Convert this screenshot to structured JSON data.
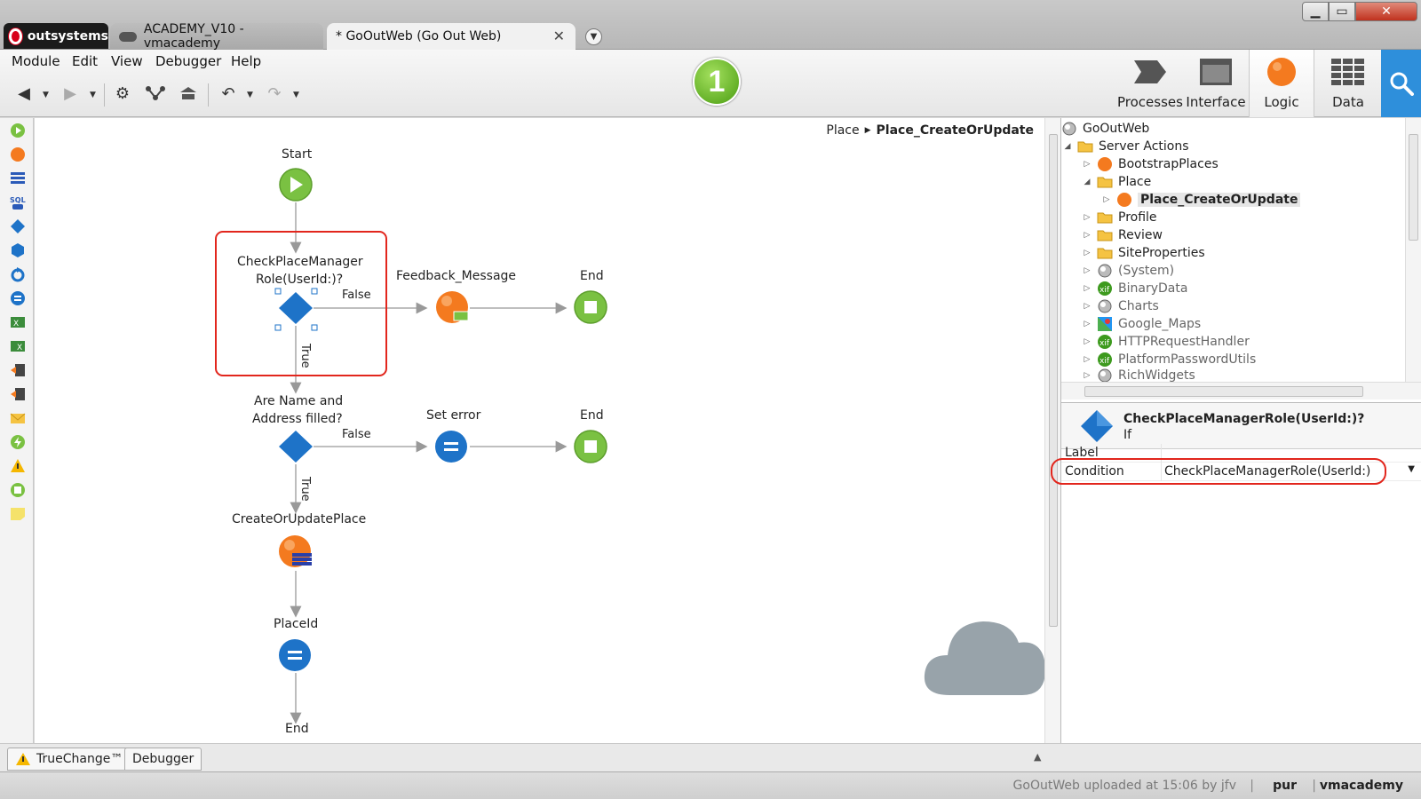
{
  "brand": {
    "name": "outsystems"
  },
  "tabs": [
    {
      "label": "ACADEMY_V10 - vmacademy"
    },
    {
      "label": "* GoOutWeb (Go Out Web)"
    }
  ],
  "window_controls": {
    "minimize": "▁",
    "maximize": "▭",
    "close": "✕"
  },
  "menu": [
    "Module",
    "Edit",
    "View",
    "Debugger",
    "Help"
  ],
  "step_badge": "1",
  "layers": [
    {
      "label": "Processes",
      "icon": "processes-icon"
    },
    {
      "label": "Interface",
      "icon": "interface-icon"
    },
    {
      "label": "Logic",
      "icon": "logic-icon",
      "active": true
    },
    {
      "label": "Data",
      "icon": "data-icon"
    }
  ],
  "breadcrumb": {
    "parent": "Place",
    "current": "Place_CreateOrUpdate"
  },
  "flow": {
    "start_label": "Start",
    "if1_label_line1": "CheckPlaceManager",
    "if1_label_line2": "Role(UserId:)?",
    "if1_false": "False",
    "if1_true": "True",
    "feedback_label": "Feedback_Message",
    "end1_label": "End",
    "if2_label_line1": "Are Name and",
    "if2_label_line2": "Address filled?",
    "if2_false": "False",
    "if2_true": "True",
    "set_error_label": "Set error",
    "end2_label": "End",
    "create_label": "CreateOrUpdatePlace",
    "placeid_label": "PlaceId",
    "end3_label": "End"
  },
  "tree": {
    "root": "GoOutWeb",
    "server_actions": "Server Actions",
    "items": [
      {
        "label": "BootstrapPlaces",
        "icon": "action-icon"
      },
      {
        "label": "Place",
        "icon": "folder-open-icon"
      },
      {
        "label": "Place_CreateOrUpdate",
        "icon": "action-icon"
      },
      {
        "label": "Profile",
        "icon": "folder-icon"
      },
      {
        "label": "Review",
        "icon": "folder-icon"
      },
      {
        "label": "SiteProperties",
        "icon": "folder-icon"
      },
      {
        "label": "(System)",
        "icon": "module-icon"
      },
      {
        "label": "BinaryData",
        "icon": "extension-icon"
      },
      {
        "label": "Charts",
        "icon": "module-icon"
      },
      {
        "label": "Google_Maps",
        "icon": "maps-icon"
      },
      {
        "label": "HTTPRequestHandler",
        "icon": "extension-icon"
      },
      {
        "label": "PlatformPasswordUtils",
        "icon": "extension-icon"
      },
      {
        "label": "RichWidgets",
        "icon": "module-icon"
      }
    ]
  },
  "properties": {
    "title": "CheckPlaceManagerRole(UserId:)?",
    "type": "If",
    "label_key": "Label",
    "label_value": "",
    "condition_key": "Condition",
    "condition_value": "CheckPlaceManagerRole(UserId:)"
  },
  "bottom_tabs": [
    "TrueChange™",
    "Debugger"
  ],
  "status": {
    "message": "GoOutWeb uploaded at 15:06 by jfv",
    "env": "pur",
    "user": "vmacademy"
  },
  "colors": {
    "accent_blue": "#2e8fdb",
    "start_green": "#7ac142",
    "action_orange": "#f47a1f",
    "if_blue": "#1e73c8",
    "highlight_red": "#e2261d"
  }
}
